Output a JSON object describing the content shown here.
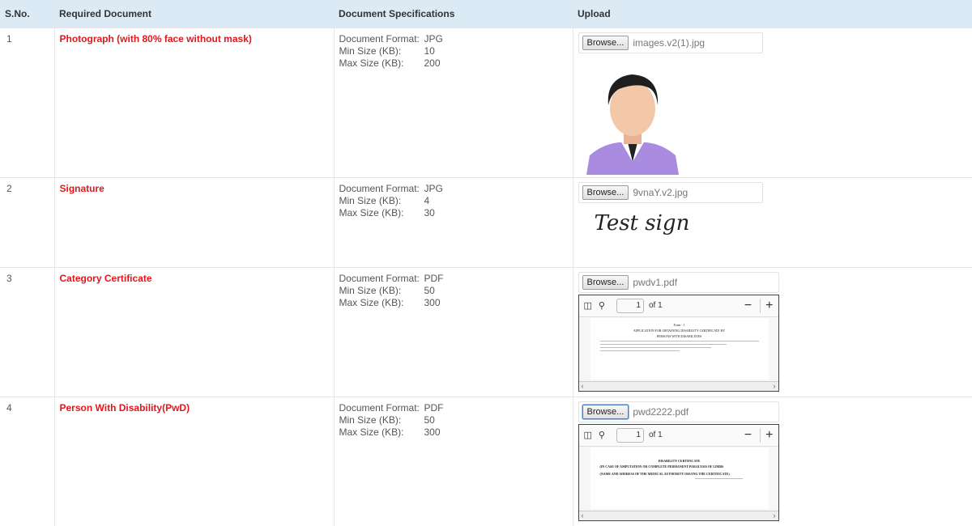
{
  "header": {
    "sno": "S.No.",
    "required": "Required Document",
    "specs": "Document Specifications",
    "upload": "Upload"
  },
  "spec_labels": {
    "format": "Document Format:",
    "min": "Min Size (KB):",
    "max": "Max Size (KB):"
  },
  "browse_label": "Browse...",
  "rows": [
    {
      "sno": "1",
      "doc": "Photograph (with 80% face without mask)",
      "format": "JPG",
      "min": "10",
      "max": "200",
      "file": "images.v2(1).jpg"
    },
    {
      "sno": "2",
      "doc": "Signature",
      "format": "JPG",
      "min": "4",
      "max": "30",
      "file": "9vnaY.v2.jpg",
      "signature_text": "Test sign"
    },
    {
      "sno": "3",
      "doc": "Category Certificate",
      "format": "PDF",
      "min": "50",
      "max": "300",
      "file": "pwdv1.pdf",
      "page_num": "1",
      "page_of": "of 1",
      "pdf_title": "Form - 1",
      "pdf_line1": "APPLICATION FOR OBTAINING DISABILITY CERTIFICATE BY",
      "pdf_line2": "PERSONS WITH DISABILITIES"
    },
    {
      "sno": "4",
      "doc": "Person With Disability(PwD)",
      "format": "PDF",
      "min": "50",
      "max": "300",
      "file": "pwd2222.pdf",
      "page_num": "1",
      "page_of": "of 1",
      "pdf_title": "DISABILITY CERTIFICATE",
      "pdf_line1": "(IN CASE OF AMPUTATION OR COMPLETE PERMANENT PARALYSIS OF LIMBS",
      "pdf_line2": "(NAME AND ADDRESS OF THE MEDICAL AUTHORITY ISSUING THE CERTIFICATE)"
    }
  ]
}
